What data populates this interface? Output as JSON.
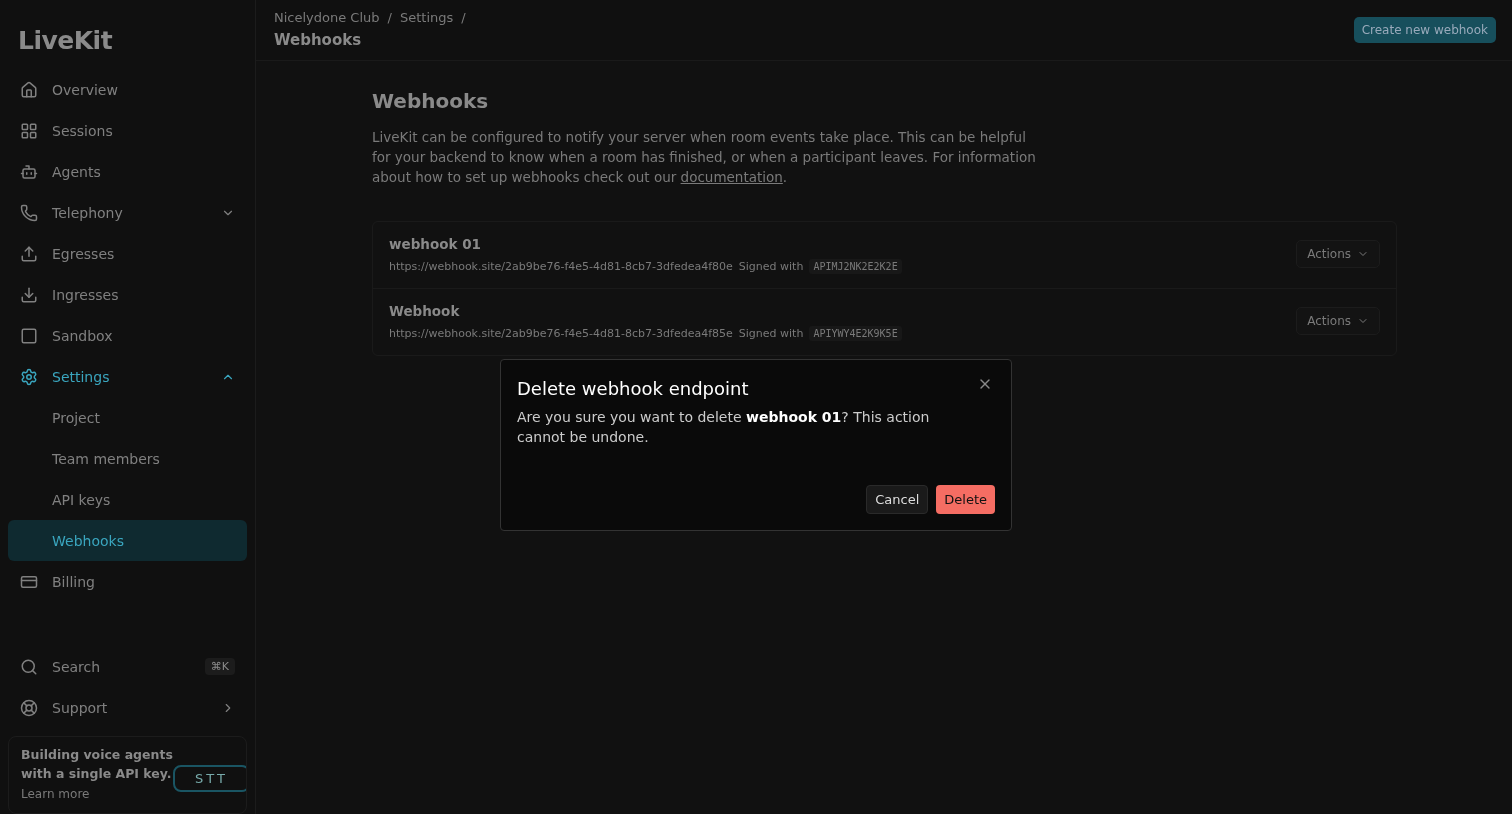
{
  "sidebar": {
    "logo": "LiveKit",
    "items": [
      {
        "label": "Overview",
        "selected": false
      },
      {
        "label": "Sessions",
        "selected": false
      },
      {
        "label": "Agents",
        "selected": false
      },
      {
        "label": "Telephony",
        "selected": false,
        "expanded": false
      },
      {
        "label": "Egresses",
        "selected": false
      },
      {
        "label": "Ingresses",
        "selected": false
      },
      {
        "label": "Sandbox",
        "selected": false
      },
      {
        "label": "Settings",
        "selected": true,
        "expanded": true,
        "children": [
          {
            "label": "Project",
            "selected": false
          },
          {
            "label": "Team members",
            "selected": false
          },
          {
            "label": "API keys",
            "selected": false
          },
          {
            "label": "Webhooks",
            "selected": true
          }
        ]
      },
      {
        "label": "Billing",
        "selected": false
      }
    ],
    "search": {
      "label": "Search",
      "shortcut": "⌘K"
    },
    "support": {
      "label": "Support"
    },
    "promo": {
      "text": "Building voice agents with a single API key.",
      "link": "Learn more",
      "tag": "STT"
    }
  },
  "breadcrumb": [
    {
      "label": "Nicelydone Club",
      "separator": "/"
    },
    {
      "label": "Settings",
      "separator": "/"
    }
  ],
  "page_title": "Webhooks",
  "create_button": "Create new webhook",
  "section": {
    "title": "Webhooks",
    "description": "LiveKit can be configured to notify your server when room events take place. This can be helpful for your backend to know when a room has finished, or when a participant leaves. For information about how to set up webhooks check out our ",
    "link": "documentation",
    "after_link": "."
  },
  "webhooks": [
    {
      "name": "webhook 01",
      "url": "https://webhook.site/2ab9be76-f4e5-4d81-8cb7-3dfedea4f80e",
      "signed_label": "Signed with",
      "key": "APIMJ2NK2E2K2E",
      "actions": "Actions"
    },
    {
      "name": "Webhook",
      "url": "https://webhook.site/2ab9be76-f4e5-4d81-8cb7-3dfedea4f85e",
      "signed_label": "Signed with",
      "key": "APIYWY4E2K9K5E",
      "actions": "Actions"
    }
  ],
  "dialog": {
    "title": "Delete webhook endpoint",
    "message": "Are you sure you want to delete **webhook 01**? This action cannot be undone.",
    "buttons": [
      {
        "label": "Cancel",
        "kind": "secondary"
      },
      {
        "label": "Delete",
        "kind": "danger"
      }
    ]
  }
}
